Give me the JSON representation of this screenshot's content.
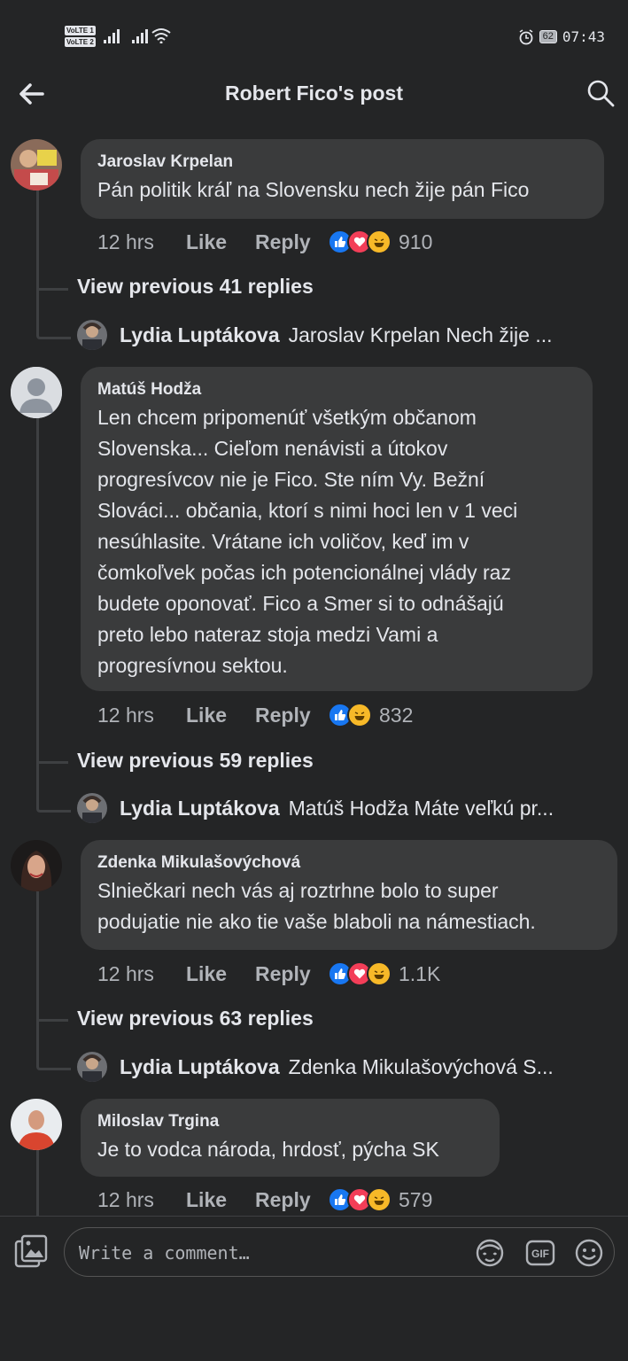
{
  "status_bar": {
    "volte1": "VoLTE 1",
    "volte2": "VoLTE 2",
    "battery": "62",
    "time": "07:43"
  },
  "header": {
    "title": "Robert Fico's post",
    "back_icon": "arrow-left-icon",
    "search_icon": "search-icon"
  },
  "comments": [
    {
      "author": "Jaroslav Krpelan",
      "text": "Pán politik kráľ na Slovensku nech žije pán Fico",
      "time": "12 hrs",
      "like": "Like",
      "reply": "Reply",
      "reactions": [
        "like",
        "love",
        "haha"
      ],
      "count": "910",
      "view_previous": "View previous 41 replies",
      "last_reply": {
        "author": "Lydia Luptákova",
        "text": "Jaroslav Krpelan Nech žije ..."
      }
    },
    {
      "author": "Matúš Hodža",
      "text_lines": [
        "Len chcem pripomenúť všetkým občanom",
        "Slovenska... Cieľom nenávisti a útokov",
        "progresívcov nie je Fico. Ste ním Vy. Bežní",
        "Slováci... občania, ktorí s nimi hoci len v 1 veci",
        "nesúhlasite. Vrátane ich voličov, keď im v",
        "čomkoľvek počas ich potencionálnej vlády raz",
        "budete oponovať. Fico a Smer si to odnášajú",
        "preto lebo nateraz stoja medzi Vami a",
        "progresívnou sektou."
      ],
      "time": "12 hrs",
      "like": "Like",
      "reply": "Reply",
      "reactions": [
        "like",
        "haha"
      ],
      "count": "832",
      "view_previous": "View previous 59 replies",
      "last_reply": {
        "author": "Lydia Luptákova",
        "text": "Matúš Hodža Máte veľkú pr..."
      }
    },
    {
      "author": "Zdenka Mikulašových​ová",
      "text_lines": [
        "Slniečkari nech vás aj roztrhne  bolo to super",
        "podujatie nie ako tie vaše blaboli na námestiach."
      ],
      "time": "12 hrs",
      "like": "Like",
      "reply": "Reply",
      "reactions": [
        "like",
        "love",
        "haha"
      ],
      "count": "1.1K",
      "view_previous": "View previous 63 replies",
      "last_reply": {
        "author": "Lydia Luptákova",
        "text": "Zdenka Mikulašovýchová S..."
      }
    },
    {
      "author": "Miloslav Trgina",
      "text": "Je to vodca národa, hrdosť, pýcha SK",
      "time": "12 hrs",
      "like": "Like",
      "reply": "Reply",
      "reactions": [
        "like",
        "love",
        "haha"
      ],
      "count": "579"
    }
  ],
  "composer": {
    "placeholder": "Write a comment…",
    "icons": [
      "photo-icon",
      "avatar-sticker-icon",
      "gif-icon",
      "emoji-icon"
    ],
    "gif_label": "GIF"
  },
  "colors": {
    "background": "#242526",
    "bubble": "#3a3b3c",
    "text": "#e4e6eb",
    "secondary": "#b0b3b8",
    "like_blue": "#1877f2",
    "love_red": "#f33e58",
    "haha_yellow": "#f7b928"
  }
}
